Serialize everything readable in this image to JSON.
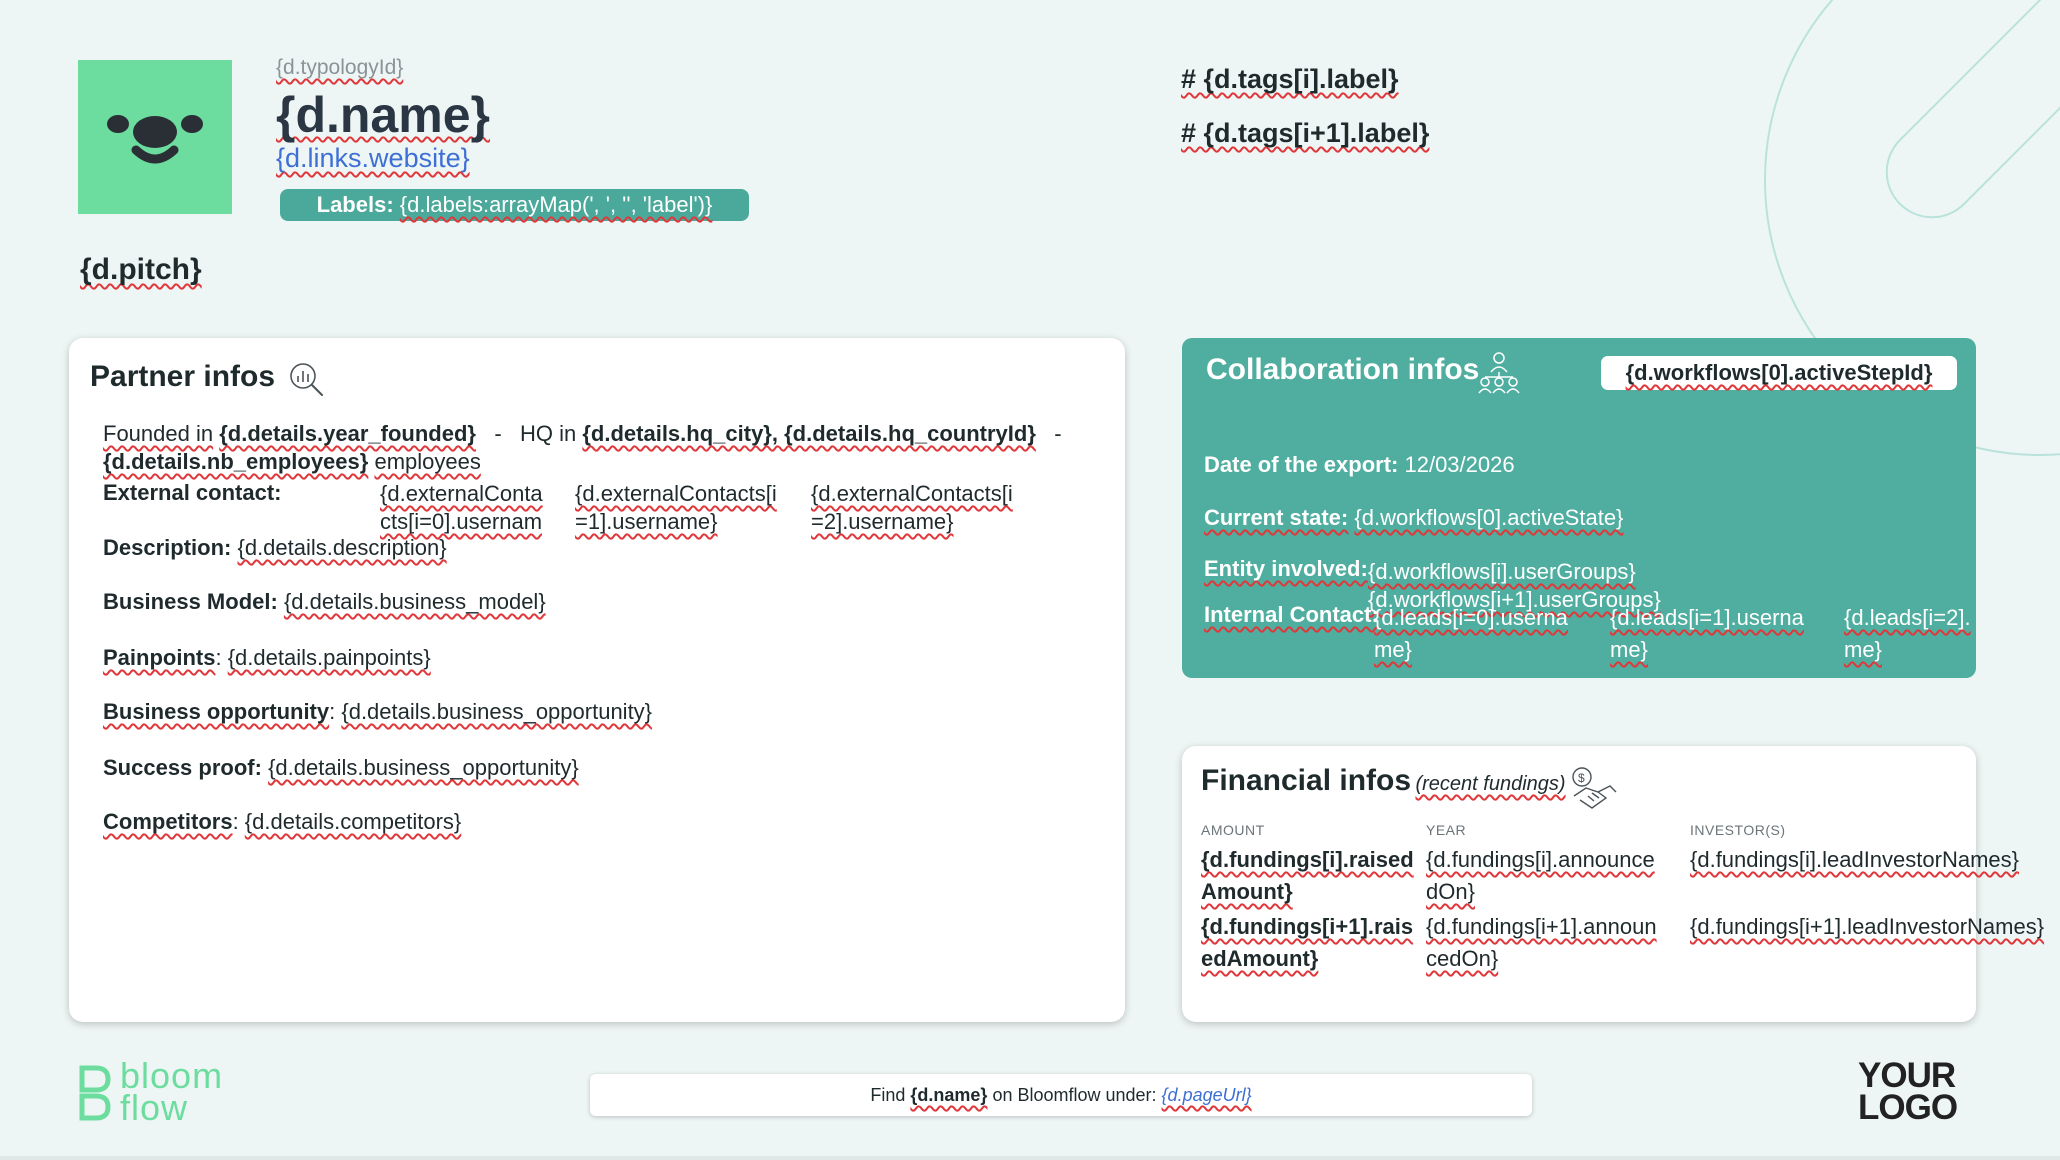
{
  "header": {
    "typology": "{d.typologyId}",
    "name": "{d.name}",
    "website": "{d.links.website}",
    "labels_prefix": "Labels:",
    "labels_value": "{d.labels:arrayMap(', ', '', 'label')}",
    "tag1": "# {d.tags[i].label}",
    "tag2": "# {d.tags[i+1].label}",
    "pitch": "{d.pitch}"
  },
  "partner": {
    "title": "Partner infos",
    "founded_label": "Founded in",
    "founded_value": "{d.details.year_founded}",
    "sep1": "-",
    "hq_label": "HQ in",
    "hq_value": "{d.details.hq_city}, {d.details.hq_countryId}",
    "sep2": "-",
    "employees_value": "{d.details.nb_employees}",
    "employees_label": "employees",
    "external_label": "External contact:",
    "ext1a": "{d.externalConta",
    "ext1b": "cts[i=0].usernam",
    "ext2a": "{d.externalContacts[i",
    "ext2b": "=1].username}",
    "ext3a": "{d.externalContacts[i",
    "ext3b": "=2].username}",
    "description_label": "Description:",
    "description_value": "{d.details.description}",
    "business_model_label": "Business Model:",
    "business_model_value": "{d.details.business_model}",
    "painpoints_label": "Painpoints",
    "painpoints_value": "{d.details.painpoints}",
    "opportunity_label": "Business opportunity",
    "opportunity_value": "{d.details.business_opportunity}",
    "success_label": "Success proof:",
    "success_value": "{d.details.business_opportunity}",
    "competitors_label": "Competitors",
    "competitors_value": "{d.details.competitors}"
  },
  "collab": {
    "title": "Collaboration infos",
    "step": "{d.workflows[0].activeStepId}",
    "export_label": "Date of the export:",
    "export_value": "12/03/2026",
    "state_label": "Current state:",
    "state_value": "{d.workflows[0].activeState}",
    "entity_label": "Entity involved:",
    "entity_value1": "{d.workflows[i].userGroups}",
    "entity_value2": "{d.workflows[i+1].userGroups}",
    "internal_label": "Internal Contact:",
    "lead1a": "{d.leads[i=0].userna",
    "lead1b": "me}",
    "lead2a": "{d.leads[i=1].userna",
    "lead2b": "me}",
    "lead3a": "{d.leads[i=2].",
    "lead3b": "me}"
  },
  "financial": {
    "title": "Financial infos",
    "subtitle": "(recent fundings)",
    "col_amount": "AMOUNT",
    "col_year": "YEAR",
    "col_investors": "INVESTOR(S)",
    "r1_amount_a": "{d.fundings[i].raised",
    "r1_amount_b": "Amount}",
    "r1_year_a": "{d.fundings[i].announce",
    "r1_year_b": "dOn}",
    "r1_investors": "{d.fundings[i].leadInvestorNames}",
    "r2_amount_a": "{d.fundings[i+1].rais",
    "r2_amount_b": "edAmount}",
    "r2_year_a": "{d.fundings[i+1].announ",
    "r2_year_b": "cedOn}",
    "r2_investors": "{d.fundings[i+1].leadInvestorNames}"
  },
  "footer": {
    "brand_line1": "bloom",
    "brand_line2": "flow",
    "find_prefix": "Find",
    "find_name": "{d.name}",
    "find_middle": "on Bloomflow under:",
    "find_url": "{d.pageUrl}",
    "logo_line1": "YOUR",
    "logo_line2": "LOGO"
  },
  "colors": {
    "teal": "#4fae9f",
    "mint": "#6cdd9f",
    "link": "#3d6fd4",
    "background": "#eef6f5"
  },
  "icons": [
    "smile-face-icon",
    "magnifier-chart-icon",
    "people-network-icon",
    "money-handshake-icon",
    "bloomflow-logo-icon"
  ]
}
